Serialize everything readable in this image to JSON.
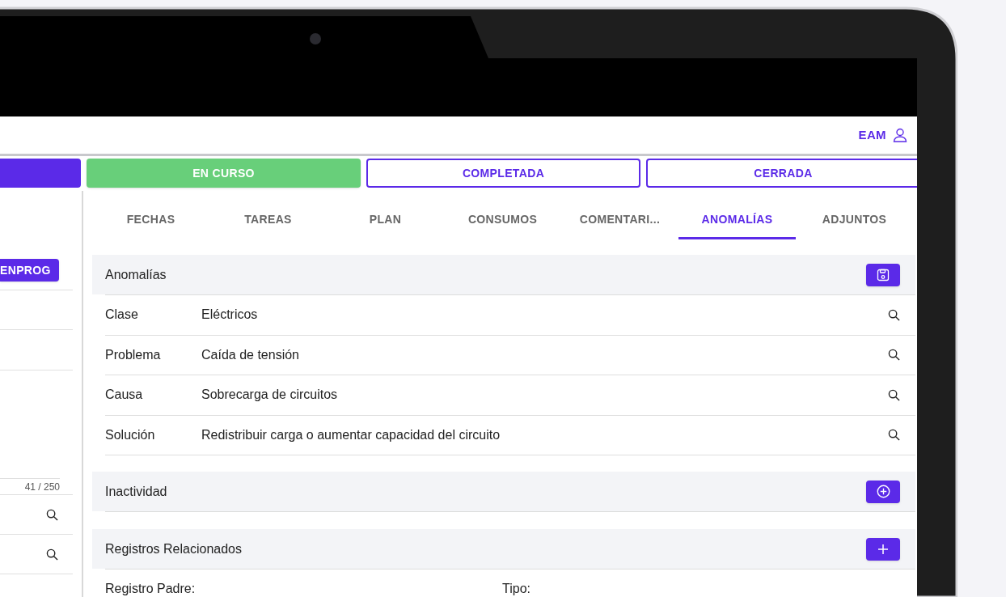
{
  "header": {
    "user": "EAM"
  },
  "status_buttons": [
    {
      "kind": "filled"
    },
    {
      "kind": "current",
      "label": "EN CURSO"
    },
    {
      "kind": "outline",
      "label": "COMPLETADA"
    },
    {
      "kind": "outline",
      "label": "CERRADA"
    }
  ],
  "left_panel": {
    "status_button": "ENPROG",
    "char_counter": "41 / 250"
  },
  "tabs": [
    {
      "label": "FECHAS",
      "selected": false
    },
    {
      "label": "TAREAS",
      "selected": false
    },
    {
      "label": "PLAN",
      "selected": false
    },
    {
      "label": "CONSUMOS",
      "selected": false
    },
    {
      "label": "COMENTARI...",
      "selected": false
    },
    {
      "label": "ANOMALÍAS",
      "selected": true
    },
    {
      "label": "ADJUNTOS",
      "selected": false
    }
  ],
  "sections": [
    {
      "title": "Anomalías",
      "kind": "save",
      "fields": [
        {
          "label": "Clase",
          "value": "Eléctricos"
        },
        {
          "label": "Problema",
          "value": "Caída de tensión"
        },
        {
          "label": "Causa",
          "value": "Sobrecarga de circuitos"
        },
        {
          "label": "Solución",
          "value": "Redistribuir carga o aumentar capacidad del circuito"
        }
      ]
    },
    {
      "title": "Inactividad",
      "kind": "add_circle"
    },
    {
      "title": "Registros Relacionados",
      "kind": "add",
      "labels": [
        "Registro Padre:",
        "Tipo:"
      ]
    }
  ]
}
